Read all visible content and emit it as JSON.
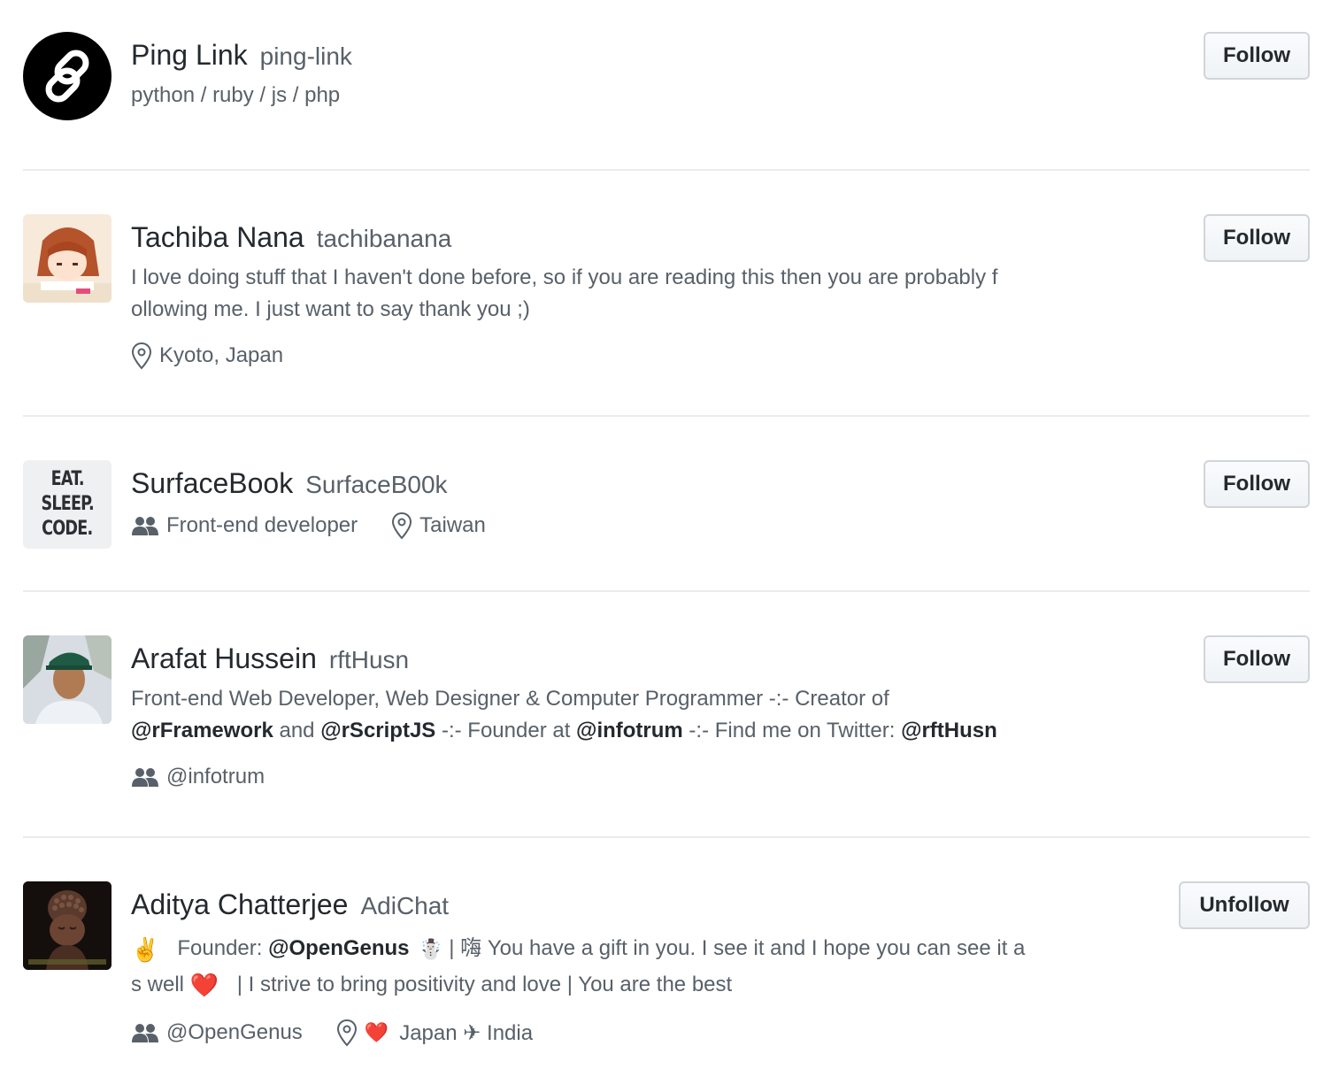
{
  "users": [
    {
      "name": "Ping Link",
      "login": "ping-link",
      "bio": "python / ruby / js / php",
      "button": "Follow"
    },
    {
      "name": "Tachiba Nana",
      "login": "tachibanana",
      "bio_line1": "I love doing stuff that I haven't done before, so if you are reading this then you are probably f",
      "bio_line2": "ollowing me. I just want to say thank you ;)",
      "location": "Kyoto, Japan",
      "button": "Follow"
    },
    {
      "name": "SurfaceBook",
      "login": "SurfaceB00k",
      "avatar_text": [
        "EAT.",
        "SLEEP.",
        "CODE."
      ],
      "company": "Front-end developer",
      "location": "Taiwan",
      "button": "Follow"
    },
    {
      "name": "Arafat Hussein",
      "login": "rftHusn",
      "bio_line1": "Front-end Web Developer, Web Designer & Computer Programmer -:- Creator of",
      "bio_line2": {
        "mention1": "@rFramework",
        "text1": " and ",
        "mention2": "@rScriptJS",
        "text2": " -:- Founder at ",
        "mention3": "@infotrum",
        "text3": " -:- Find me on Twitter: ",
        "mention4": "@rftHusn"
      },
      "company": "@infotrum",
      "button": "Follow"
    },
    {
      "name": "Aditya Chatterjee",
      "login": "AdiChat",
      "bio_line1": {
        "emoji1": "✌️",
        "text1": "Founder: ",
        "mention": "@OpenGenus",
        "emoji2": "☃️",
        "text2": " | 嗨 You have a gift in you. I see it and I hope you can see it a"
      },
      "bio_line2": {
        "text1": "s well ",
        "emoji": "❤️",
        "text2": " | I strive to bring positivity and love | You are the best"
      },
      "company": "@OpenGenus",
      "location": {
        "emoji": "❤️",
        "text": "Japan ✈ India"
      },
      "button": "Unfollow"
    }
  ],
  "colors": {
    "text_primary": "#24292e",
    "text_secondary": "#586069",
    "divider": "#eaecef",
    "button_border": "#d1d5da"
  }
}
